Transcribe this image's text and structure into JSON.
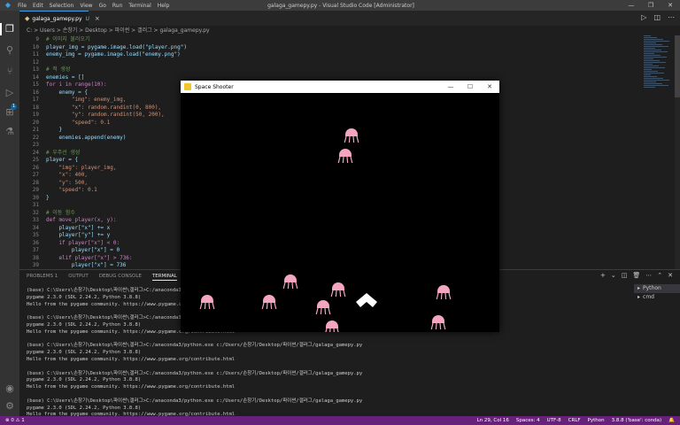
{
  "menu": [
    "File",
    "Edit",
    "Selection",
    "View",
    "Go",
    "Run",
    "Terminal",
    "Help"
  ],
  "window_title": "galaga_gamepy.py - Visual Studio Code [Administrator]",
  "tab": {
    "name": "galaga_gamepy.py",
    "modified": "U",
    "close": "×"
  },
  "breadcrumb": "C: > Users > 손창기 > Desktop > 파이썬 > 갤러그 > galaga_gamepy.py",
  "code_lines": [
    {
      "n": "9",
      "t": "# 이미지 불러오기"
    },
    {
      "n": "10",
      "t": "player_img = pygame.image.load(\"player.png\")"
    },
    {
      "n": "11",
      "t": "enemy_img = pygame.image.load(\"enemy.png\")"
    },
    {
      "n": "12",
      "t": ""
    },
    {
      "n": "13",
      "t": "# 적 생성"
    },
    {
      "n": "14",
      "t": "enemies = []"
    },
    {
      "n": "15",
      "t": "for i in range(10):"
    },
    {
      "n": "16",
      "t": "    enemy = {"
    },
    {
      "n": "17",
      "t": "        \"img\": enemy_img,"
    },
    {
      "n": "18",
      "t": "        \"x\": random.randint(0, 800),"
    },
    {
      "n": "19",
      "t": "        \"y\": random.randint(50, 200),"
    },
    {
      "n": "20",
      "t": "        \"speed\": 0.1"
    },
    {
      "n": "21",
      "t": "    }"
    },
    {
      "n": "22",
      "t": "    enemies.append(enemy)"
    },
    {
      "n": "23",
      "t": ""
    },
    {
      "n": "24",
      "t": "# 우주선 생성"
    },
    {
      "n": "25",
      "t": "player = {"
    },
    {
      "n": "26",
      "t": "    \"img\": player_img,"
    },
    {
      "n": "27",
      "t": "    \"x\": 400,"
    },
    {
      "n": "28",
      "t": "    \"y\": 500,"
    },
    {
      "n": "29",
      "t": "    \"speed\": 0.1"
    },
    {
      "n": "30",
      "t": "}"
    },
    {
      "n": "31",
      "t": ""
    },
    {
      "n": "32",
      "t": "# 이동 함수"
    },
    {
      "n": "33",
      "t": "def move_player(x, y):"
    },
    {
      "n": "34",
      "t": "    player[\"x\"] += x"
    },
    {
      "n": "35",
      "t": "    player[\"y\"] += y"
    },
    {
      "n": "36",
      "t": "    if player[\"x\"] < 0:"
    },
    {
      "n": "37",
      "t": "        player[\"x\"] = 0"
    },
    {
      "n": "38",
      "t": "    elif player[\"x\"] > 736:"
    },
    {
      "n": "39",
      "t": "        player[\"x\"] = 736"
    }
  ],
  "panel_tabs": [
    "PROBLEMS",
    "OUTPUT",
    "DEBUG CONSOLE",
    "TERMINAL"
  ],
  "panel_tab_count": "1",
  "terminal_lines": [
    "(base) C:\\Users\\손창기\\Desktop\\파이썬\\갤러그>C:/anaconda3/python.exe c:/Users/손창기/Desktop/파이썬/갤러그/galaga_gamepy.py",
    "pygame 2.3.0 (SDL 2.24.2, Python 3.8.8)",
    "Hello from the pygame community. https://www.pygame.org/contribute.html",
    "",
    "(base) C:\\Users\\손창기\\Desktop\\파이썬\\갤러그>C:/anaconda3/python.exe c:/Users/손창기/Desktop/파이썬/갤러그/galaga_gamepy.py",
    "pygame 2.3.0 (SDL 2.24.2, Python 3.8.8)",
    "Hello from the pygame community. https://www.pygame.org/contribute.html",
    "",
    "(base) C:\\Users\\손창기\\Desktop\\파이썬\\갤러그>C:/anaconda3/python.exe c:/Users/손창기/Desktop/파이썬/갤러그/galaga_gamepy.py",
    "pygame 2.3.0 (SDL 2.24.2, Python 3.8.8)",
    "Hello from the pygame community. https://www.pygame.org/contribute.html",
    "",
    "(base) C:\\Users\\손창기\\Desktop\\파이썬\\갤러그>C:/anaconda3/python.exe c:/Users/손창기/Desktop/파이썬/갤러그/galaga_gamepy.py",
    "pygame 2.3.0 (SDL 2.24.2, Python 3.8.8)",
    "Hello from the pygame community. https://www.pygame.org/contribute.html",
    "",
    "(base) C:\\Users\\손창기\\Desktop\\파이썬\\갤러그>C:/anaconda3/python.exe c:/Users/손창기/Desktop/파이썬/갤러그/galaga_gamepy.py",
    "pygame 2.3.0 (SDL 2.24.2, Python 3.8.8)",
    "Hello from the pygame community. https://www.pygame.org/contribute.html",
    "▯"
  ],
  "terminal_list": [
    "Python",
    "cmd"
  ],
  "status": {
    "left": "⊗ 0  ⚠ 1",
    "position": "Ln 29, Col 16",
    "spaces": "Spaces: 4",
    "encoding": "UTF-8",
    "eol": "CRLF",
    "language": "Python",
    "interpreter": "3.8.8 ('base': conda)"
  },
  "game": {
    "title": "Space Shooter",
    "enemy_color": "#f4a6c0",
    "player_color": "#ffffff"
  },
  "colors": {
    "accent": "#3fa0e8",
    "statusbar": "#68217a"
  }
}
